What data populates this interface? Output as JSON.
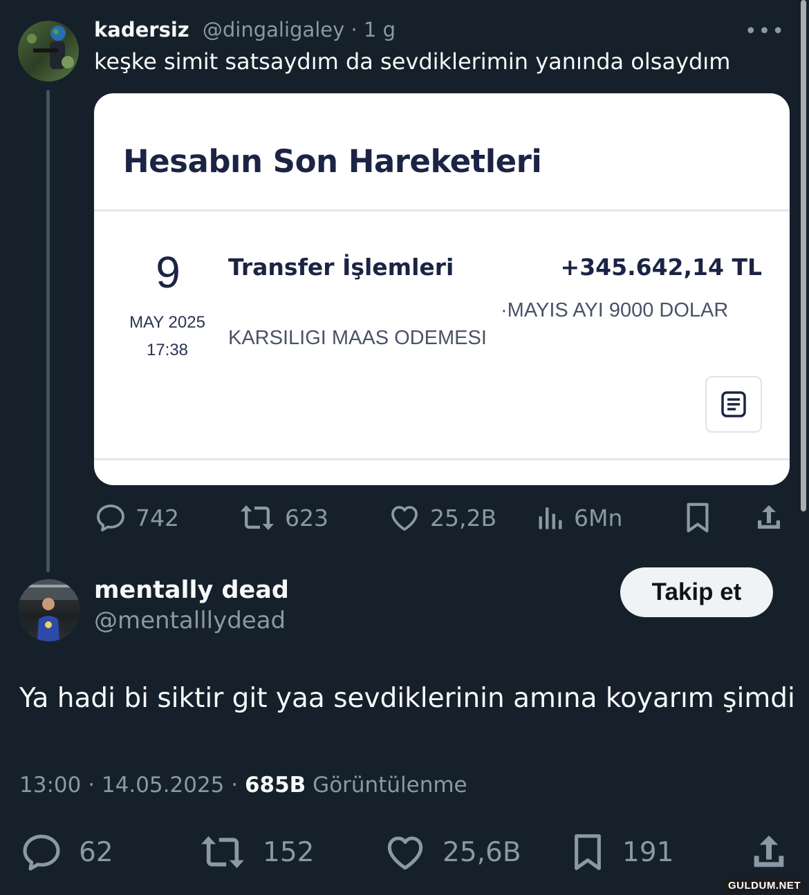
{
  "tweet1": {
    "name": "kadersiz",
    "handle": "@dingaligaley",
    "time": "1 g",
    "text": "keşke simit satsaydım da sevdiklerimin yanında olsaydım",
    "card": {
      "title": "Hesabın Son Hareketleri",
      "day": "9",
      "month_year": "MAY 2025",
      "time": "17:38",
      "tx_title": "Transfer İşlemleri",
      "amount": "+345.642,14 TL",
      "desc_line1": "·MAYIS AYI 9000 DOLAR",
      "desc_line2": "KARSILIGI MAAS ODEMESI"
    },
    "stats": {
      "replies": "742",
      "retweets": "623",
      "likes": "25,2B",
      "views": "6Mn"
    }
  },
  "tweet2": {
    "name": "mentally dead",
    "handle": "@mentalllydead",
    "follow_label": "Takip et",
    "text": "Ya hadi bi siktir git yaa sevdiklerinin amına koyarım şimdi",
    "time": "13:00",
    "date": "14.05.2025",
    "views": "685B",
    "views_label": "Görüntülenme",
    "stats": {
      "replies": "62",
      "retweets": "152",
      "likes": "25,6B",
      "bookmarks": "191"
    }
  },
  "watermark": "GULDUM.NET",
  "colors": {
    "background": "#15202b",
    "muted": "#8b98a5",
    "text": "#f7f9f9",
    "card_bg": "#ffffff",
    "card_text": "#1b2444"
  },
  "icons": [
    "more-icon",
    "reply-icon",
    "retweet-icon",
    "like-icon",
    "views-icon",
    "bookmark-icon",
    "share-icon",
    "receipt-icon"
  ]
}
